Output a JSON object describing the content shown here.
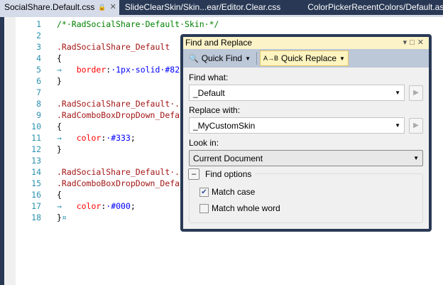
{
  "tabs": [
    {
      "label": "SocialShare.Default.css",
      "active": true,
      "locked": true
    },
    {
      "label": "SlideClearSkin/Skin...ear/Editor.Clear.css"
    },
    {
      "label": "ColorPickerRecentColors/Default.aspx"
    }
  ],
  "editor": {
    "lines": [
      {
        "n": "1",
        "segs": [
          [
            "c-comment",
            "/*·RadSocialShare·Default·Skin·*/"
          ]
        ]
      },
      {
        "n": "2",
        "segs": []
      },
      {
        "n": "3",
        "segs": [
          [
            "c-sel",
            ".RadSocialShare_Default"
          ]
        ]
      },
      {
        "n": "4",
        "segs": [
          [
            "c-p",
            "{"
          ]
        ]
      },
      {
        "n": "5",
        "segs": [
          [
            "c-ws",
            "→   "
          ],
          [
            "c-prop",
            "border"
          ],
          [
            "c-p",
            ":"
          ],
          [
            "c-val",
            "·1px·solid·#82"
          ]
        ]
      },
      {
        "n": "6",
        "segs": [
          [
            "c-p",
            "}"
          ]
        ]
      },
      {
        "n": "7",
        "segs": []
      },
      {
        "n": "8",
        "segs": [
          [
            "c-sel",
            ".RadSocialShare_Default·."
          ]
        ]
      },
      {
        "n": "9",
        "segs": [
          [
            "c-sel",
            ".RadComboBoxDropDown_Defa"
          ]
        ]
      },
      {
        "n": "10",
        "segs": [
          [
            "c-p",
            "{"
          ]
        ]
      },
      {
        "n": "11",
        "segs": [
          [
            "c-ws",
            "→   "
          ],
          [
            "c-prop",
            "color"
          ],
          [
            "c-p",
            ":"
          ],
          [
            "c-val",
            "·#333"
          ],
          [
            "c-p",
            ";"
          ]
        ]
      },
      {
        "n": "12",
        "segs": [
          [
            "c-p",
            "}"
          ]
        ]
      },
      {
        "n": "13",
        "segs": []
      },
      {
        "n": "14",
        "segs": [
          [
            "c-sel",
            ".RadSocialShare_Default·."
          ]
        ]
      },
      {
        "n": "15",
        "segs": [
          [
            "c-sel",
            ".RadComboBoxDropDown_Defa"
          ]
        ]
      },
      {
        "n": "16",
        "segs": [
          [
            "c-p",
            "{"
          ]
        ]
      },
      {
        "n": "17",
        "segs": [
          [
            "c-ws",
            "→   "
          ],
          [
            "c-prop",
            "color"
          ],
          [
            "c-p",
            ":"
          ],
          [
            "c-val",
            "·#000"
          ],
          [
            "c-p",
            ";"
          ]
        ]
      },
      {
        "n": "18",
        "segs": [
          [
            "c-p",
            "}"
          ],
          [
            "c-ws",
            "¤"
          ]
        ]
      }
    ]
  },
  "dialog": {
    "title": "Find and Replace",
    "quick_find": "Quick Find",
    "quick_replace": "Quick Replace",
    "find_label": "Find what:",
    "find_value": "_Default",
    "replace_label": "Replace with:",
    "replace_value": "_MyCustomSkin",
    "lookin_label": "Look in:",
    "lookin_value": "Current Document",
    "options_label": "Find options",
    "match_case": {
      "label": "Match case",
      "checked": true
    },
    "match_word": {
      "label": "Match whole word",
      "checked": false
    }
  }
}
